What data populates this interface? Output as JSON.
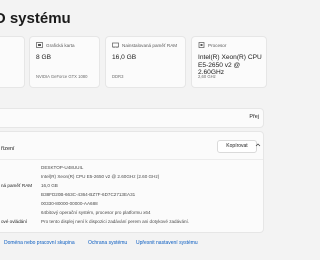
{
  "header": {
    "title": "O systému"
  },
  "cards": [
    {
      "icon": "device-icon",
      "label": "",
      "value": "",
      "sub": ""
    },
    {
      "icon": "gpu-icon",
      "label": "Grafická karta",
      "value": "8 GB",
      "sub": "NVIDIA GeForce GTX 1080"
    },
    {
      "icon": "ram-icon",
      "label": "Nainstalovaná paměť RAM",
      "value": "16,0 GB",
      "sub": "DDR3"
    },
    {
      "icon": "cpu-icon",
      "label": "Procesor",
      "value": "Intel(R) Xeon(R) CPU E5-2650 v2 @ 2.60GHz",
      "sub": "2,60 GHz"
    }
  ],
  "rename_label": "Přej",
  "specs": {
    "title": "řízení",
    "copy_label": "Kopírovat",
    "rows": [
      {
        "label": "",
        "value": "DESKTOP-U48UUIL"
      },
      {
        "label": "",
        "value": "Intel(R) Xeon(R) CPU E5-2650 v2 @ 2.60GHz (2.60 GHz)"
      },
      {
        "label": "ná paměť RAM",
        "value": "16,0 GB"
      },
      {
        "label": "",
        "value": "B38FD20B-663C-4364-BZ7F-6D7C2713EA31"
      },
      {
        "label": "",
        "value": "00330-80000-00000-AA688"
      },
      {
        "label": "",
        "value": "64bitový operační systém, procesor pro platformu x64"
      },
      {
        "label": "ové ovládání",
        "value": "Pro tento displej není k dispozici zadávání perem ani dotykové zadávání."
      }
    ]
  },
  "links": [
    "Doména nebo pracovní skupina",
    "Ochrana systému",
    "Upřesnit nastavení systému"
  ]
}
